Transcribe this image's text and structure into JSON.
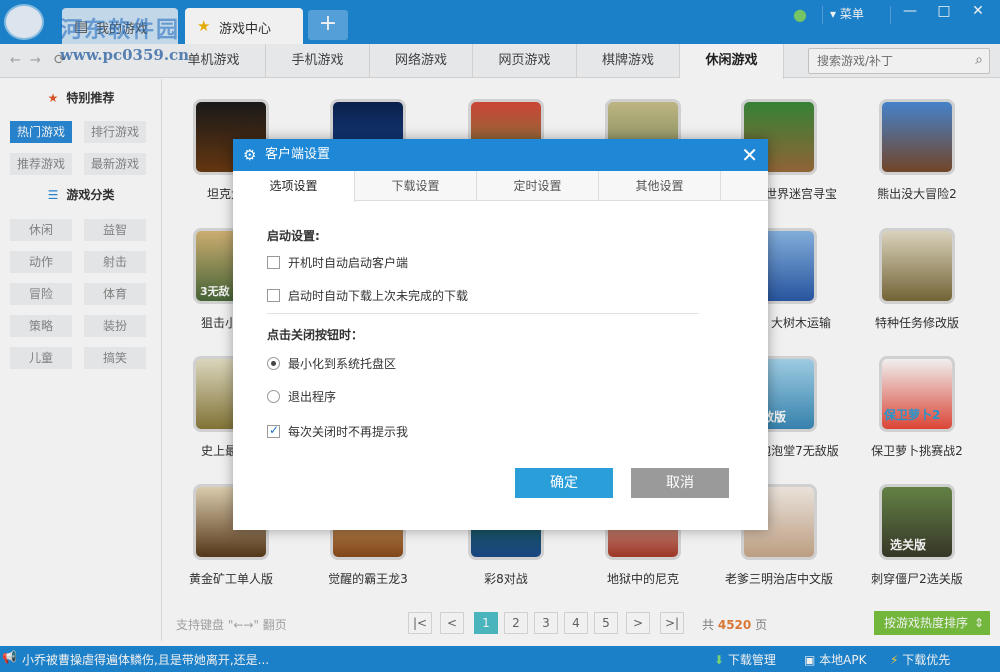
{
  "topbar": {
    "tabs": [
      {
        "label": "我的游戏",
        "icon": "home-icon"
      },
      {
        "label": "游戏中心",
        "icon": "star-icon"
      }
    ],
    "add_tab": "+",
    "watermark": "河东软件园",
    "watermark_url": "www.pc0359.cn",
    "menu_label": "菜单"
  },
  "categories": [
    "单机游戏",
    "手机游戏",
    "网络游戏",
    "网页游戏",
    "棋牌游戏",
    "休闲游戏"
  ],
  "active_category": "休闲游戏",
  "search": {
    "placeholder": "搜索游戏/补丁"
  },
  "sidebar": {
    "featured_title": "特别推荐",
    "featured": [
      "热门游戏",
      "排行游戏",
      "推荐游戏",
      "最新游戏"
    ],
    "category_title": "游戏分类",
    "genres": [
      "休闲",
      "益智",
      "动作",
      "射击",
      "冒险",
      "体育",
      "策略",
      "装扮",
      "儿童",
      "搞笑"
    ]
  },
  "games": [
    "坦克大战",
    "",
    "",
    "",
    "世界迷宫寻宝",
    "熊出没大冒险2",
    "狙击小日本",
    "",
    "",
    "",
    "大树木运输",
    "特种任务修改版",
    "史上最贱小",
    "",
    "",
    "",
    "泡泡堂7无敌版",
    "保卫萝卜挑赛战2",
    "黄金矿工单人版",
    "觉醒的霸王龙3",
    "彩8对战",
    "地狱中的尼克",
    "老爹三明治店中文版",
    "刺穿僵尸2选关版"
  ],
  "thumb_captions": {
    "sniper": "3无敌",
    "zombie": "选关版",
    "bomber": "敌版",
    "carrot": "保卫萝卜2"
  },
  "pager": {
    "hint": "支持键盘 \"←→\" 翻页",
    "first": "|<",
    "prev": "<",
    "next": ">",
    "last": ">|",
    "pages": [
      "1",
      "2",
      "3",
      "4",
      "5"
    ],
    "total_prefix": "共",
    "total": "4520",
    "total_suffix": "页",
    "sort_label": "按游戏热度排序"
  },
  "statusbar": {
    "news": "小乔被曹操虐得遍体鳞伤,且是带她离开,还是...",
    "download_manager": "下载管理",
    "local_apk": "本地APK",
    "download_priority": "下载优先"
  },
  "dialog": {
    "title": "客户端设置",
    "tabs": [
      "选项设置",
      "下载设置",
      "定时设置",
      "其他设置"
    ],
    "startup_title": "启动设置:",
    "startup_options": [
      {
        "label": "开机时自动启动客户端",
        "checked": false
      },
      {
        "label": "启动时自动下载上次未完成的下载",
        "checked": false
      }
    ],
    "close_title": "点击关闭按钮时：",
    "close_options": [
      {
        "label": "最小化到系统托盘区",
        "selected": true
      },
      {
        "label": "退出程序",
        "selected": false
      }
    ],
    "no_prompt": {
      "label": "每次关闭时不再提示我",
      "checked": true
    },
    "ok": "确定",
    "cancel": "取消"
  },
  "colors": {
    "primary": "#1e88d6",
    "accent_green": "#7bc240",
    "page_active": "#4fc0c9",
    "ok_button": "#2a9ed8"
  }
}
